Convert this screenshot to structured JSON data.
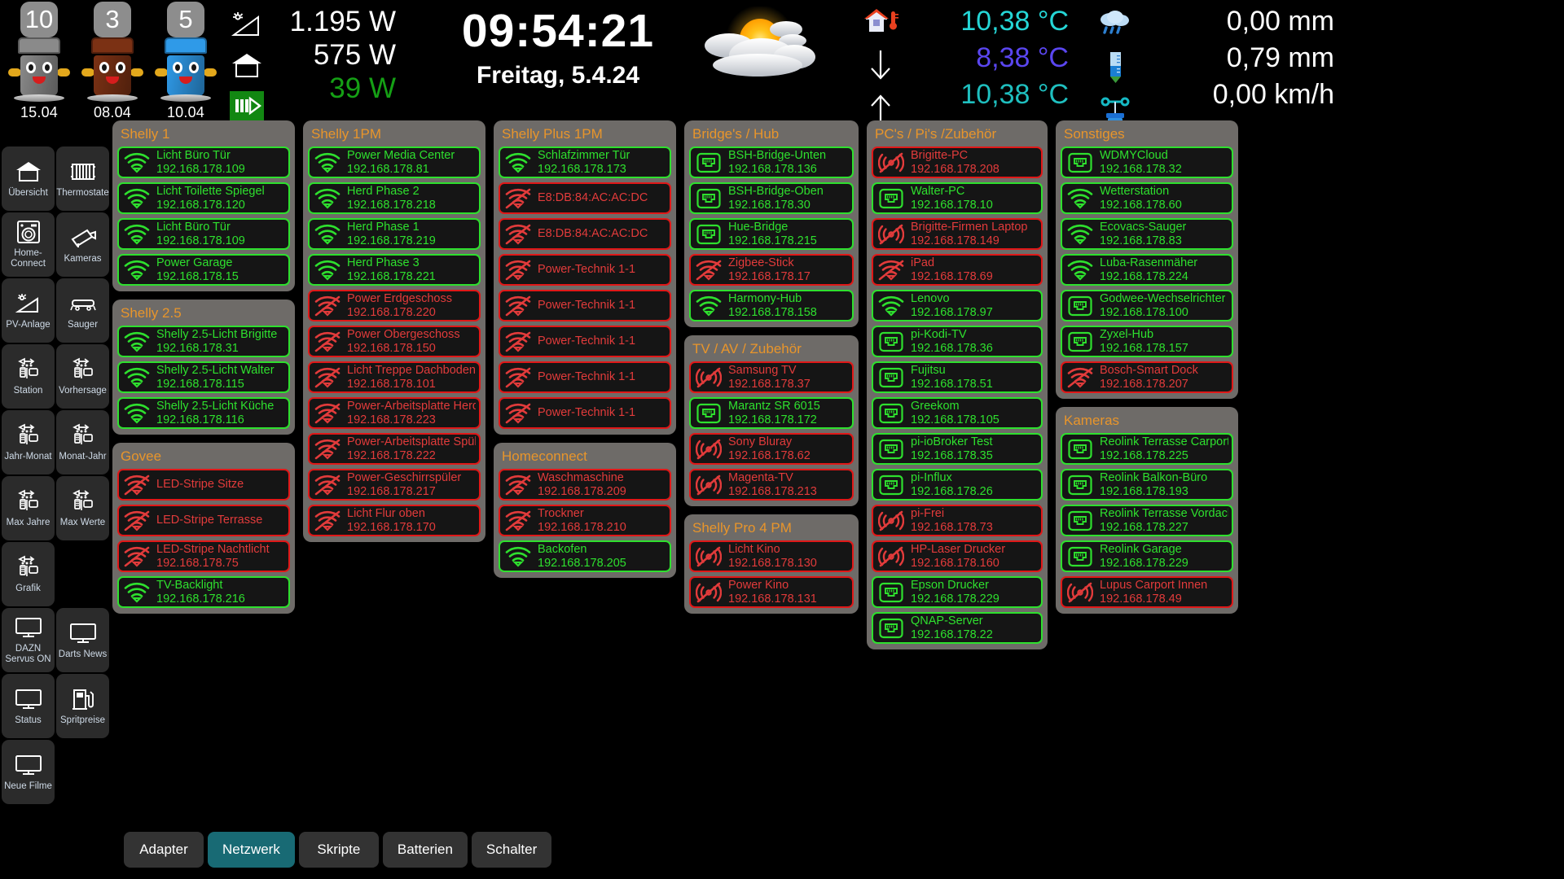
{
  "topbar": {
    "bins": [
      {
        "count": "10",
        "date": "15.04",
        "color": "#8a8a8a",
        "icon": "trash-bin-grey"
      },
      {
        "count": "3",
        "date": "08.04",
        "color": "#7b3114",
        "icon": "trash-bin-brown"
      },
      {
        "count": "5",
        "date": "10.04",
        "color": "#2f9ae8",
        "icon": "trash-bin-blue"
      }
    ],
    "power": {
      "solar_icon": "solar-panel-icon",
      "house_icon": "house-icon",
      "grid_icon": "energy-feed-icon",
      "solar_value": "1.195 W",
      "house_value": "575 W",
      "feed_value": "39 W",
      "feed_color": "#15a015"
    },
    "clock": {
      "time": "09:54:21",
      "date": "Freitag, 5.4.24"
    },
    "weather_icon": "sun-behind-cloud-icon",
    "temperature": {
      "rows": [
        {
          "icon": "house-thermometer-icon",
          "value": "10,38 °C",
          "color": "#25d6d6"
        },
        {
          "icon": "arrow-down-icon",
          "value": "8,38 °C",
          "color": "#5a46f0"
        },
        {
          "icon": "arrow-up-icon",
          "value": "10,38 °C",
          "color": "#1fbfbf"
        }
      ]
    },
    "precipitation": {
      "rows": [
        {
          "icon": "rain-cloud-icon",
          "value": "0,00 mm"
        },
        {
          "icon": "rain-gauge-icon",
          "value": "0,79 mm"
        },
        {
          "icon": "anemometer-icon",
          "value": "0,00 km/h"
        }
      ]
    }
  },
  "sidebar": {
    "items": [
      {
        "label": "Übersicht",
        "icon": "house-icon"
      },
      {
        "label": "Thermostate",
        "icon": "radiator-icon"
      },
      {
        "label": "Home-Connect",
        "icon": "washing-machine-icon"
      },
      {
        "label": "Kameras",
        "icon": "cctv-camera-icon"
      },
      {
        "label": "PV-Anlage",
        "icon": "solar-panel-icon"
      },
      {
        "label": "Sauger",
        "icon": "vacuum-robot-icon"
      },
      {
        "label": "Station",
        "icon": "weather-station-icon"
      },
      {
        "label": "Vorhersage",
        "icon": "weather-station-icon"
      },
      {
        "label": "Jahr-Monat",
        "icon": "weather-station-icon"
      },
      {
        "label": "Monat-Jahr",
        "icon": "weather-station-icon"
      },
      {
        "label": "Max Jahre",
        "icon": "weather-station-icon"
      },
      {
        "label": "Max Werte",
        "icon": "weather-station-icon"
      },
      {
        "label": "Grafik",
        "icon": "weather-station-icon"
      },
      {
        "label": "",
        "icon": "none"
      },
      {
        "label": "DAZN Servus ON",
        "icon": "monitor-icon"
      },
      {
        "label": "Darts News",
        "icon": "monitor-icon"
      },
      {
        "label": "Status",
        "icon": "monitor-icon"
      },
      {
        "label": "Spritpreise",
        "icon": "fuel-pump-icon"
      },
      {
        "label": "Neue Filme",
        "icon": "monitor-icon"
      },
      {
        "label": "",
        "icon": "none"
      }
    ]
  },
  "columns": [
    {
      "groups": [
        {
          "title": "Shelly 1",
          "devices": [
            {
              "name": "Licht Büro Tür",
              "ip": "192.168.178.109",
              "status": "online",
              "icon": "wifi-icon"
            },
            {
              "name": "Licht Toilette Spiegel",
              "ip": "192.168.178.120",
              "status": "online",
              "icon": "wifi-icon"
            },
            {
              "name": "Licht Büro Tür",
              "ip": "192.168.178.109",
              "status": "online",
              "icon": "wifi-icon"
            },
            {
              "name": "Power Garage",
              "ip": "192.168.178.15",
              "status": "online",
              "icon": "wifi-icon"
            }
          ]
        },
        {
          "title": "Shelly 2.5",
          "devices": [
            {
              "name": "Shelly 2.5-Licht Brigitte",
              "ip": "192.168.178.31",
              "status": "online",
              "icon": "wifi-icon"
            },
            {
              "name": "Shelly 2.5-Licht Walter",
              "ip": "192.168.178.115",
              "status": "online",
              "icon": "wifi-icon"
            },
            {
              "name": "Shelly 2.5-Licht Küche",
              "ip": "192.168.178.116",
              "status": "online",
              "icon": "wifi-icon"
            }
          ]
        },
        {
          "title": "Govee",
          "devices": [
            {
              "name": "LED-Stripe Sitze",
              "ip": "",
              "status": "offline",
              "icon": "wifi-off-icon"
            },
            {
              "name": "LED-Stripe Terrasse",
              "ip": "",
              "status": "offline",
              "icon": "wifi-off-icon"
            },
            {
              "name": "LED-Stripe Nachtlicht",
              "ip": "192.168.178.75",
              "status": "offline",
              "icon": "wifi-off-icon"
            },
            {
              "name": "TV-Backlight",
              "ip": "192.168.178.216",
              "status": "online",
              "icon": "wifi-icon"
            }
          ]
        }
      ]
    },
    {
      "groups": [
        {
          "title": "Shelly 1PM",
          "devices": [
            {
              "name": "Power Media Center",
              "ip": "192.168.178.81",
              "status": "online",
              "icon": "wifi-icon"
            },
            {
              "name": "Herd Phase 2",
              "ip": "192.168.178.218",
              "status": "online",
              "icon": "wifi-icon"
            },
            {
              "name": "Herd Phase 1",
              "ip": "192.168.178.219",
              "status": "online",
              "icon": "wifi-icon"
            },
            {
              "name": "Herd Phase 3",
              "ip": "192.168.178.221",
              "status": "online",
              "icon": "wifi-icon"
            },
            {
              "name": "Power Erdgeschoss",
              "ip": "192.168.178.220",
              "status": "offline",
              "icon": "wifi-off-icon"
            },
            {
              "name": "Power Obergeschoss",
              "ip": "192.168.178.150",
              "status": "offline",
              "icon": "wifi-off-icon"
            },
            {
              "name": "Licht Treppe Dachboden",
              "ip": "192.168.178.101",
              "status": "offline",
              "icon": "wifi-off-icon"
            },
            {
              "name": "Power-Arbeitsplatte Herd",
              "ip": "192.168.178.223",
              "status": "offline",
              "icon": "wifi-off-icon"
            },
            {
              "name": "Power-Arbeitsplatte Spüle",
              "ip": "192.168.178.222",
              "status": "offline",
              "icon": "wifi-off-icon"
            },
            {
              "name": "Power-Geschirrspüler",
              "ip": "192.168.178.217",
              "status": "offline",
              "icon": "wifi-off-icon"
            },
            {
              "name": "Licht Flur oben",
              "ip": "192.168.178.170",
              "status": "offline",
              "icon": "wifi-off-icon"
            }
          ]
        }
      ]
    },
    {
      "groups": [
        {
          "title": "Shelly Plus 1PM",
          "devices": [
            {
              "name": "Schlafzimmer Tür",
              "ip": "192.168.178.173",
              "status": "online",
              "icon": "wifi-icon"
            },
            {
              "name": "E8:DB:84:AC:AC:DC",
              "ip": "",
              "status": "offline",
              "icon": "wifi-off-icon"
            },
            {
              "name": "E8:DB:84:AC:AC:DC",
              "ip": "",
              "status": "offline",
              "icon": "wifi-off-icon"
            },
            {
              "name": "Power-Technik 1-1",
              "ip": "",
              "status": "offline",
              "icon": "wifi-off-icon"
            },
            {
              "name": "Power-Technik 1-1",
              "ip": "",
              "status": "offline",
              "icon": "wifi-off-icon"
            },
            {
              "name": "Power-Technik 1-1",
              "ip": "",
              "status": "offline",
              "icon": "wifi-off-icon"
            },
            {
              "name": "Power-Technik 1-1",
              "ip": "",
              "status": "offline",
              "icon": "wifi-off-icon"
            },
            {
              "name": "Power-Technik 1-1",
              "ip": "",
              "status": "offline",
              "icon": "wifi-off-icon"
            }
          ]
        },
        {
          "title": "Homeconnect",
          "devices": [
            {
              "name": "Waschmaschine",
              "ip": "192.168.178.209",
              "status": "offline",
              "icon": "wifi-off-icon"
            },
            {
              "name": "Trockner",
              "ip": "192.168.178.210",
              "status": "offline",
              "icon": "wifi-off-icon"
            },
            {
              "name": "Backofen",
              "ip": "192.168.178.205",
              "status": "online",
              "icon": "wifi-icon"
            }
          ]
        }
      ]
    },
    {
      "groups": [
        {
          "title": "Bridge's / Hub",
          "devices": [
            {
              "name": "BSH-Bridge-Unten",
              "ip": "192.168.178.136",
              "status": "online",
              "icon": "lan-icon"
            },
            {
              "name": "BSH-Bridge-Oben",
              "ip": "192.168.178.30",
              "status": "online",
              "icon": "lan-icon"
            },
            {
              "name": "Hue-Bridge",
              "ip": "192.168.178.215",
              "status": "online",
              "icon": "lan-icon"
            },
            {
              "name": "Zigbee-Stick",
              "ip": "192.168.178.17",
              "status": "offline",
              "icon": "wifi-off-icon"
            },
            {
              "name": "Harmony-Hub",
              "ip": "192.168.178.158",
              "status": "online",
              "icon": "wifi-icon"
            }
          ]
        },
        {
          "title": "TV / AV / Zubehör",
          "devices": [
            {
              "name": "Samsung TV",
              "ip": "192.168.178.37",
              "status": "offline",
              "icon": "broadcast-off-icon"
            },
            {
              "name": "Marantz SR 6015",
              "ip": "192.168.178.172",
              "status": "online",
              "icon": "lan-icon"
            },
            {
              "name": "Sony Bluray",
              "ip": "192.168.178.62",
              "status": "offline",
              "icon": "broadcast-off-icon"
            },
            {
              "name": "Magenta-TV",
              "ip": "192.168.178.213",
              "status": "offline",
              "icon": "broadcast-off-icon"
            }
          ]
        },
        {
          "title": "Shelly Pro 4 PM",
          "devices": [
            {
              "name": "Licht Kino",
              "ip": "192.168.178.130",
              "status": "offline",
              "icon": "broadcast-off-icon"
            },
            {
              "name": "Power Kino",
              "ip": "192.168.178.131",
              "status": "offline",
              "icon": "broadcast-off-icon"
            }
          ]
        }
      ]
    },
    {
      "groups": [
        {
          "title": "PC's / Pi's /Zubehör",
          "devices": [
            {
              "name": "Brigitte-PC",
              "ip": "192.168.178.208",
              "status": "offline",
              "icon": "broadcast-off-icon"
            },
            {
              "name": "Walter-PC",
              "ip": "192.168.178.10",
              "status": "online",
              "icon": "lan-icon"
            },
            {
              "name": "Brigitte-Firmen Laptop",
              "ip": "192.168.178.149",
              "status": "offline",
              "icon": "broadcast-off-icon"
            },
            {
              "name": "iPad",
              "ip": "192.168.178.69",
              "status": "offline",
              "icon": "wifi-off-icon"
            },
            {
              "name": "Lenovo",
              "ip": "192.168.178.97",
              "status": "online",
              "icon": "wifi-icon"
            },
            {
              "name": "pi-Kodi-TV",
              "ip": "192.168.178.36",
              "status": "online",
              "icon": "lan-icon"
            },
            {
              "name": "Fujitsu",
              "ip": "192.168.178.51",
              "status": "online",
              "icon": "lan-icon"
            },
            {
              "name": "Greekom",
              "ip": "192.168.178.105",
              "status": "online",
              "icon": "lan-icon"
            },
            {
              "name": "pi-ioBroker Test",
              "ip": "192.168.178.35",
              "status": "online",
              "icon": "lan-icon"
            },
            {
              "name": "pi-Influx",
              "ip": "192.168.178.26",
              "status": "online",
              "icon": "lan-icon"
            },
            {
              "name": "pi-Frei",
              "ip": "192.168.178.73",
              "status": "offline",
              "icon": "broadcast-off-icon"
            },
            {
              "name": "HP-Laser Drucker",
              "ip": "192.168.178.160",
              "status": "offline",
              "icon": "broadcast-off-icon"
            },
            {
              "name": "Epson Drucker",
              "ip": "192.168.178.229",
              "status": "online",
              "icon": "lan-icon"
            },
            {
              "name": "QNAP-Server",
              "ip": "192.168.178.22",
              "status": "online",
              "icon": "lan-icon"
            }
          ]
        }
      ]
    },
    {
      "groups": [
        {
          "title": "Sonstiges",
          "devices": [
            {
              "name": "WDMYCloud",
              "ip": "192.168.178.32",
              "status": "online",
              "icon": "lan-icon"
            },
            {
              "name": "Wetterstation",
              "ip": "192.168.178.60",
              "status": "online",
              "icon": "wifi-icon"
            },
            {
              "name": "Ecovacs-Sauger",
              "ip": "192.168.178.83",
              "status": "online",
              "icon": "wifi-icon"
            },
            {
              "name": "Luba-Rasenmäher",
              "ip": "192.168.178.224",
              "status": "online",
              "icon": "wifi-icon"
            },
            {
              "name": "Godwee-Wechselrichter",
              "ip": "192.168.178.100",
              "status": "online",
              "icon": "lan-icon"
            },
            {
              "name": "Zyxel-Hub",
              "ip": "192.168.178.157",
              "status": "online",
              "icon": "lan-icon"
            },
            {
              "name": "Bosch-Smart Dock",
              "ip": "192.168.178.207",
              "status": "offline",
              "icon": "wifi-off-icon"
            }
          ]
        },
        {
          "title": "Kameras",
          "devices": [
            {
              "name": "Reolink Terrasse Carport",
              "ip": "192.168.178.225",
              "status": "online",
              "icon": "lan-icon"
            },
            {
              "name": "Reolink Balkon-Büro",
              "ip": "192.168.178.193",
              "status": "online",
              "icon": "lan-icon"
            },
            {
              "name": "Reolink Terrasse Vordach",
              "ip": "192.168.178.227",
              "status": "online",
              "icon": "lan-icon"
            },
            {
              "name": "Reolink Garage",
              "ip": "192.168.178.229",
              "status": "online",
              "icon": "lan-icon"
            },
            {
              "name": "Lupus Carport Innen",
              "ip": "192.168.178.49",
              "status": "offline",
              "icon": "broadcast-off-icon"
            }
          ]
        }
      ]
    }
  ],
  "tabs": [
    {
      "label": "Adapter",
      "active": false
    },
    {
      "label": "Netzwerk",
      "active": true
    },
    {
      "label": "Skripte",
      "active": false
    },
    {
      "label": "Batterien",
      "active": false
    },
    {
      "label": "Schalter",
      "active": false
    }
  ],
  "colors": {
    "online": "#2ee02e",
    "offline": "#e01818",
    "group_title": "#e8952b",
    "group_bg": "#6e6b68",
    "tab_active": "#186a74"
  }
}
